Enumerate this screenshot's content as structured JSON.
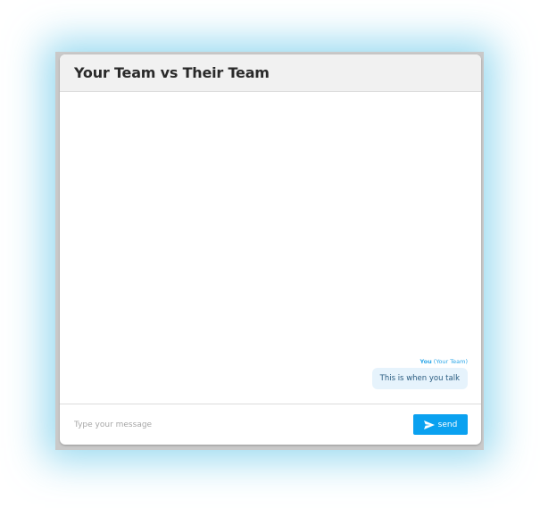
{
  "header": {
    "title": "Your Team vs Their Team"
  },
  "messages": [
    {
      "sender_name": "You",
      "sender_team": "(Your Team)",
      "text": "This is when you talk"
    }
  ],
  "composer": {
    "placeholder": "Type your message",
    "value": "",
    "send_label": "send",
    "send_icon": "paper-plane-icon"
  },
  "colors": {
    "accent": "#0aa1f0",
    "bubble_bg": "#e6f3fc",
    "glow": "#78cdeb"
  }
}
